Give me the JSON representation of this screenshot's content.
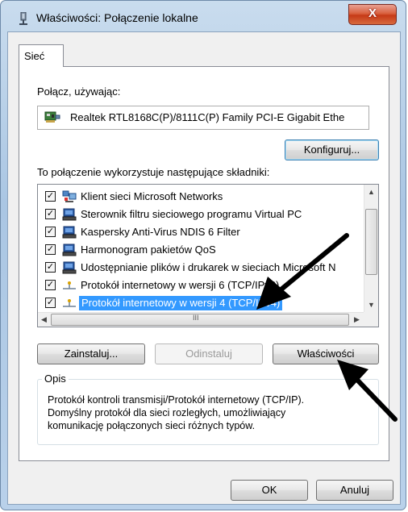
{
  "window": {
    "title": "Właściwości: Połączenie lokalne",
    "close_label": "X"
  },
  "tabs": [
    {
      "label": "Sieć"
    }
  ],
  "connect_using": {
    "label": "Połącz, używając:",
    "adapter": "Realtek RTL8168C(P)/8111C(P) Family PCI-E Gigabit Ethe"
  },
  "buttons": {
    "configure": "Konfiguruj...",
    "install": "Zainstaluj...",
    "uninstall": "Odinstaluj",
    "properties": "Właściwości",
    "ok": "OK",
    "cancel": "Anuluj"
  },
  "components": {
    "label": "To połączenie wykorzystuje następujące składniki:",
    "items": [
      {
        "label": "Klient sieci Microsoft Networks",
        "checked": true,
        "icon": "network-client-icon"
      },
      {
        "label": "Sterownik filtru sieciowego programu Virtual PC",
        "checked": true,
        "icon": "network-service-icon"
      },
      {
        "label": "Kaspersky Anti-Virus NDIS 6 Filter",
        "checked": true,
        "icon": "network-service-icon"
      },
      {
        "label": "Harmonogram pakietów QoS",
        "checked": true,
        "icon": "network-service-icon"
      },
      {
        "label": "Udostępnianie plików i drukarek w sieciach Microsoft N",
        "checked": true,
        "icon": "network-service-icon"
      },
      {
        "label": "Protokół internetowy w wersji 6 (TCP/IPv6)",
        "checked": true,
        "icon": "protocol-icon"
      },
      {
        "label": "Protokół internetowy w wersji 4 (TCP/IPv4)",
        "checked": true,
        "icon": "protocol-icon",
        "selected": true
      }
    ]
  },
  "description": {
    "title": "Opis",
    "lines": [
      "Protokół kontroli transmisji/Protokół internetowy (TCP/IP).",
      "Domyślny protokół dla sieci rozległych, umożliwiający",
      "komunikację połączonych sieci różnych typów."
    ]
  },
  "scrollbar": {
    "h_thumb_label": "III"
  },
  "colors": {
    "selection": "#3399ff",
    "title_gradient": "#b9d1ea",
    "close": "#c63a17"
  }
}
